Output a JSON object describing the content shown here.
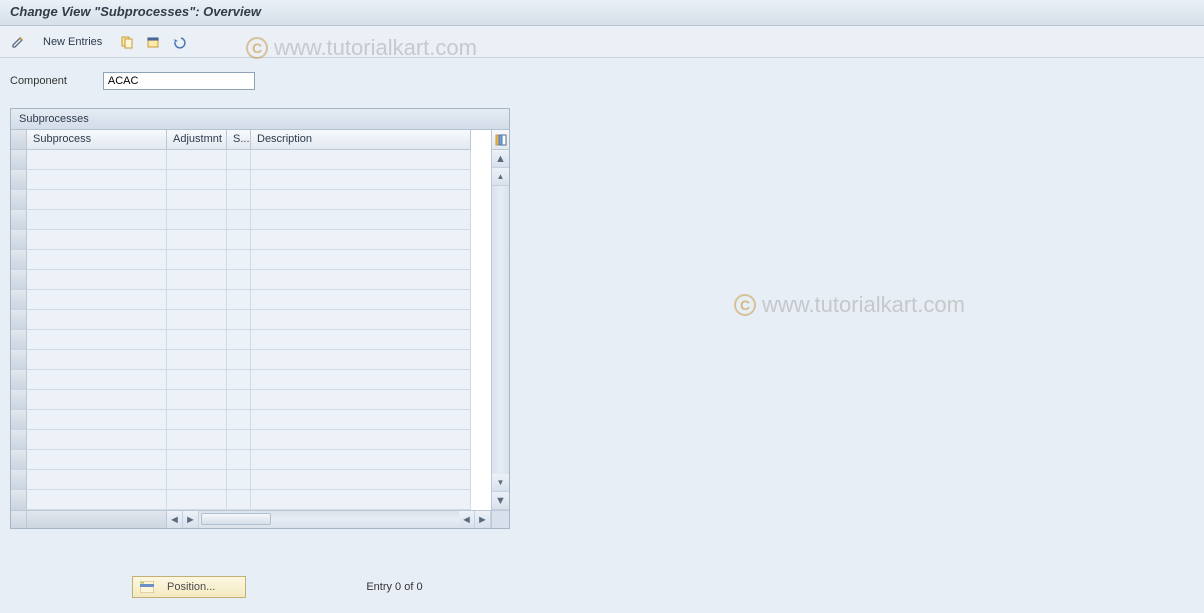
{
  "titlebar": {
    "title": "Change View \"Subprocesses\": Overview"
  },
  "toolbar": {
    "new_entries_label": "New Entries"
  },
  "field": {
    "component_label": "Component",
    "component_value": "ACAC"
  },
  "panel": {
    "title": "Subprocesses",
    "columns": {
      "subprocess": "Subprocess",
      "adjustment": "Adjustmnt",
      "s": "S...",
      "description": "Description"
    }
  },
  "bottom": {
    "position_label": "Position...",
    "entry_status": "Entry 0 of 0"
  },
  "watermark": {
    "text": "www.tutorialkart.com"
  }
}
